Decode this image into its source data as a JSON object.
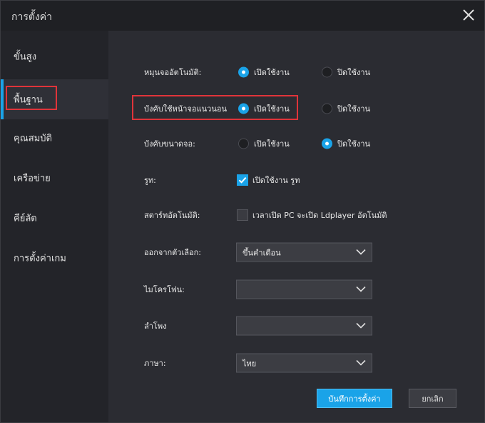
{
  "window": {
    "title": "การตั้งค่า"
  },
  "sidebar": {
    "items": [
      {
        "label": "ขั้นสูง"
      },
      {
        "label": "พื้นฐาน"
      },
      {
        "label": "คุณสมบัติ"
      },
      {
        "label": "เครือข่าย"
      },
      {
        "label": "คีย์ลัด"
      },
      {
        "label": "การตั้งค่าเกม"
      }
    ],
    "active_index": 1
  },
  "settings": {
    "auto_rotate": {
      "label": "หมุนจออัตโนมัติ:",
      "on_label": "เปิดใช้งาน",
      "off_label": "ปิดใช้งาน",
      "selected": "on"
    },
    "force_landscape": {
      "label": "บังคับใช้หน้าจอแนวนอน",
      "on_label": "เปิดใช้งาน",
      "off_label": "ปิดใช้งาน",
      "selected": "on"
    },
    "force_resolution": {
      "label": "บังคับขนาดจอ:",
      "on_label": "เปิดใช้งาน",
      "off_label": "ปิดใช้งาน",
      "selected": "off"
    },
    "root": {
      "label": "รูท:",
      "checkbox_label": "เปิดใช้งาน รูท",
      "checked": true
    },
    "autostart": {
      "label": "สตาร์ทอัตโนมัติ:",
      "checkbox_label": "เวลาเปิด PC จะเปิด Ldplayer อัตโนมัติ",
      "checked": false
    },
    "exit_option": {
      "label": "ออกจากตัวเลือก:",
      "value": "ขึ้นคำเตือน"
    },
    "microphone": {
      "label": "ไมโครโฟน:",
      "value": ""
    },
    "speaker": {
      "label": "ลำโพง",
      "value": ""
    },
    "language": {
      "label": "ภาษา:",
      "value": "ไทย"
    }
  },
  "buttons": {
    "save": "บันทึกการตั้งค่า",
    "cancel": "ยกเลิก"
  },
  "colors": {
    "accent": "#1aa3e8",
    "highlight": "#e0343a",
    "background": "#2b2c32",
    "sidebar": "#232429"
  }
}
